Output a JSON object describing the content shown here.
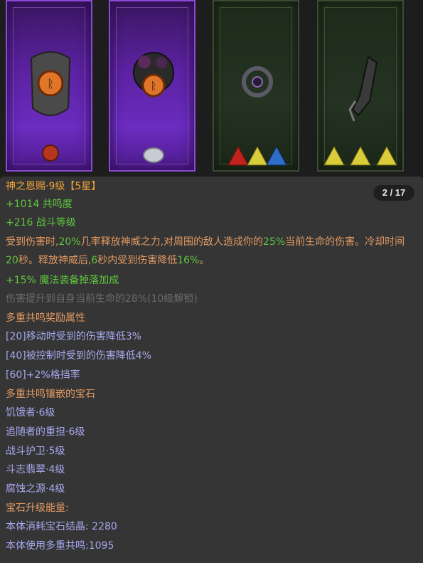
{
  "header": {
    "title": "神之恩赐·9级【5星】",
    "page_indicator": "2 / 17"
  },
  "stats": {
    "resonance": "+1014 共鸣度",
    "combat_level": "+216 战斗等级"
  },
  "description": {
    "p1": "受到伤害时,",
    "v1": "20%",
    "p2": "几率释放神威之力,对周围的敌人造成你的",
    "v2": "25%",
    "p3": "当前生命的伤害。冷却时间",
    "v3": "20",
    "p4": "秒。释放神威后,",
    "v4": "6",
    "p5": "秒内受到伤害降低",
    "v5": "16%",
    "p6": "。"
  },
  "magic_drop": "+15% 魔法装备掉落加成",
  "locked_bonus": "伤害提升到自身当前生命的28%(10级解锁)",
  "resonance_rewards": {
    "heading": "多重共鸣奖励属性",
    "items": [
      "[20]移动时受到的伤害降低3%",
      "[40]被控制时受到的伤害降低4%",
      "[60]+2%格挡率"
    ]
  },
  "gems": {
    "heading": "多重共鸣镶嵌的宝石",
    "items": [
      "饥饿者·6级",
      "追随者的重担·6级",
      "战斗护卫·5级",
      "斗志翡翠·4级",
      "腐蚀之源·4级"
    ]
  },
  "upgrade": {
    "heading": "宝石升级能量:",
    "crystal": "本体消耗宝石结晶: 2280",
    "resonance": "本体使用多重共鸣:1095"
  },
  "colors": {
    "title": "#f0a23a",
    "green": "#5fc73e",
    "orange": "#e39a62",
    "blue": "#a8a8f0",
    "gray": "#6a6a6a"
  },
  "icons": {
    "card1": "rune-shield-icon",
    "card2": "rune-rose-icon",
    "card3": "amulet-icon",
    "card4": "gauntlet-icon"
  }
}
